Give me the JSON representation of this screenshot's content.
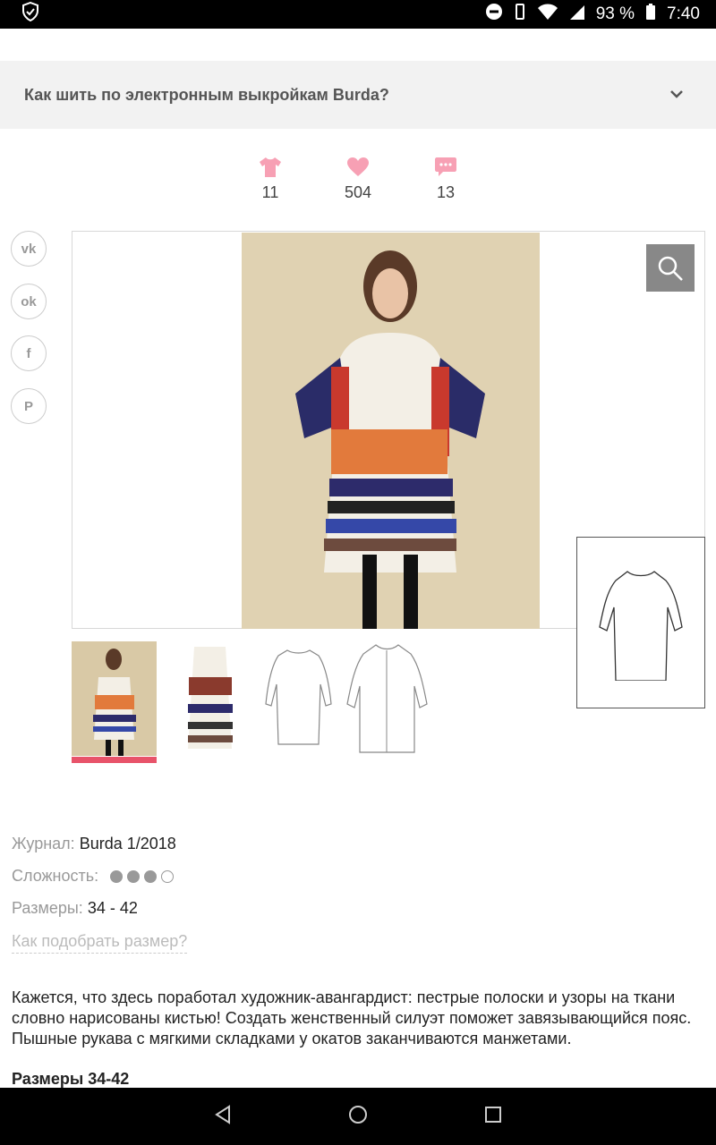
{
  "status_bar": {
    "battery_text": "93 %",
    "time": "7:40"
  },
  "accordion": {
    "title": "Как шить по электронным выкройкам Burda?"
  },
  "stats": [
    {
      "icon": "tshirt-icon",
      "count": "11"
    },
    {
      "icon": "heart-icon",
      "count": "504"
    },
    {
      "icon": "comment-icon",
      "count": "13"
    }
  ],
  "social": [
    {
      "name": "vk",
      "glyph": "vk"
    },
    {
      "name": "odnoklassniki",
      "glyph": "ok"
    },
    {
      "name": "facebook",
      "glyph": "f"
    },
    {
      "name": "pinterest",
      "glyph": "P"
    }
  ],
  "meta": {
    "journal_label": "Журнал:",
    "journal_value": "Burda 1/2018",
    "difficulty_label": "Сложность:",
    "difficulty_level": 3,
    "difficulty_max": 4,
    "sizes_label": "Размеры:",
    "sizes_value": "34 - 42",
    "size_link": "Как подобрать размер?"
  },
  "description": {
    "text": "Кажется, что здесь поработал художник-авангардист: пестрые полоски и узоры на ткани словно нарисованы кистью! Создать женственный силуэт поможет завязывающийся пояс. Пышные рукава с мягкими складками у окатов заканчиваются манжетами.",
    "sizes": "Размеры 34-42"
  },
  "colors": {
    "accent": "#e8536a",
    "stat_icon": "#f7a0b4",
    "zoom_bg": "#888888",
    "accordion_bg": "#f2f2f2"
  }
}
